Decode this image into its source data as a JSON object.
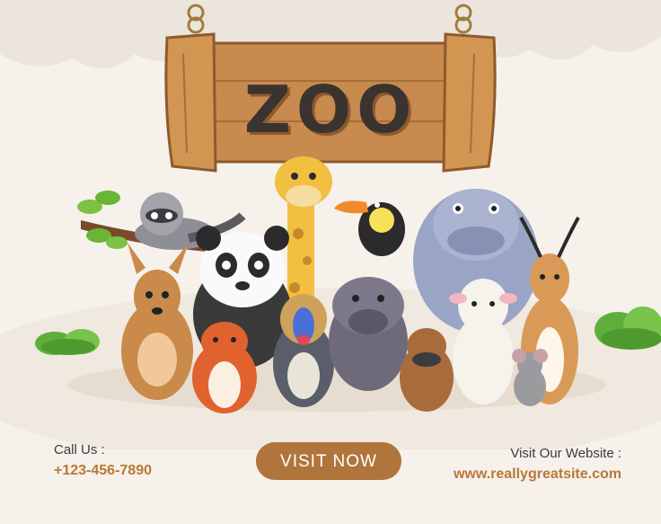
{
  "sign": {
    "title": "ZOO"
  },
  "contact": {
    "call_label": "Call Us :",
    "call_number": "+123-456-7890"
  },
  "cta": {
    "visit_label": "VISIT NOW"
  },
  "website": {
    "label": "Visit Our Website :",
    "url": "www.reallygreatsite.com"
  },
  "colors": {
    "background": "#f6f1ea",
    "accent": "#b0753c",
    "accent_text": "#b8783a",
    "wood": "#c88a4e",
    "sign_text": "#3a3330"
  },
  "illustration": {
    "animals": [
      "raccoon",
      "giraffe",
      "toucan",
      "hippo",
      "panda",
      "kangaroo",
      "fox",
      "mandrill",
      "warthog",
      "antelope",
      "platypus",
      "sheep",
      "mouse"
    ]
  }
}
